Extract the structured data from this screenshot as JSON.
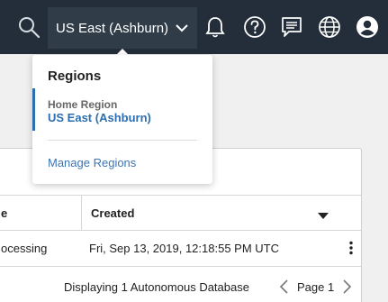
{
  "header": {
    "region_label": "US East (Ashburn)",
    "icons": [
      "search-icon",
      "chevron-down-icon",
      "bell-icon",
      "help-icon",
      "chat-icon",
      "globe-icon",
      "user-icon"
    ]
  },
  "regions_menu": {
    "title": "Regions",
    "home_region_label": "Home Region",
    "home_region_value": "US East (Ashburn)",
    "manage_link": "Manage Regions"
  },
  "table": {
    "columns": [
      "e",
      "Created"
    ],
    "rows": [
      {
        "state": "ocessing",
        "created": "Fri, Sep 13, 2019, 12:18:55 PM UTC"
      }
    ]
  },
  "footer": {
    "summary": "Displaying 1 Autonomous Database",
    "page_label": "Page 1"
  },
  "colors": {
    "navbar_bg": "#242e3a",
    "accent_blue": "#2c6eb2"
  }
}
